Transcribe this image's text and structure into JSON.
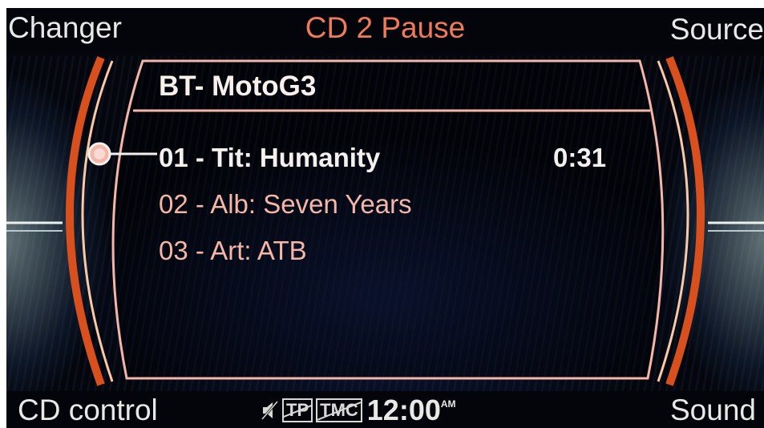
{
  "topbar": {
    "left_softkey": "Changer",
    "title": "CD 2 Pause",
    "right_softkey": "Source"
  },
  "panel": {
    "header": "BT- MotoG3",
    "items": [
      {
        "label": "01 - Tit: Humanity",
        "time": "0:31"
      },
      {
        "label": "02 - Alb: Seven Years"
      },
      {
        "label": "03 - Art: ATB"
      }
    ]
  },
  "bottombar": {
    "left_softkey": "CD control",
    "right_softkey": "Sound",
    "tp_badge": "TP",
    "tmc_badge": "TMC",
    "clock": "12:00",
    "clock_suffix": "AM"
  },
  "icons": {
    "mute": "speaker-mute-icon",
    "selector": "selection-knob-icon"
  },
  "colors": {
    "accent": "#f07a5a",
    "frame": "#f3b6a8",
    "arc_outer": "#d8501e",
    "arc_inner": "#f9c9a8"
  }
}
